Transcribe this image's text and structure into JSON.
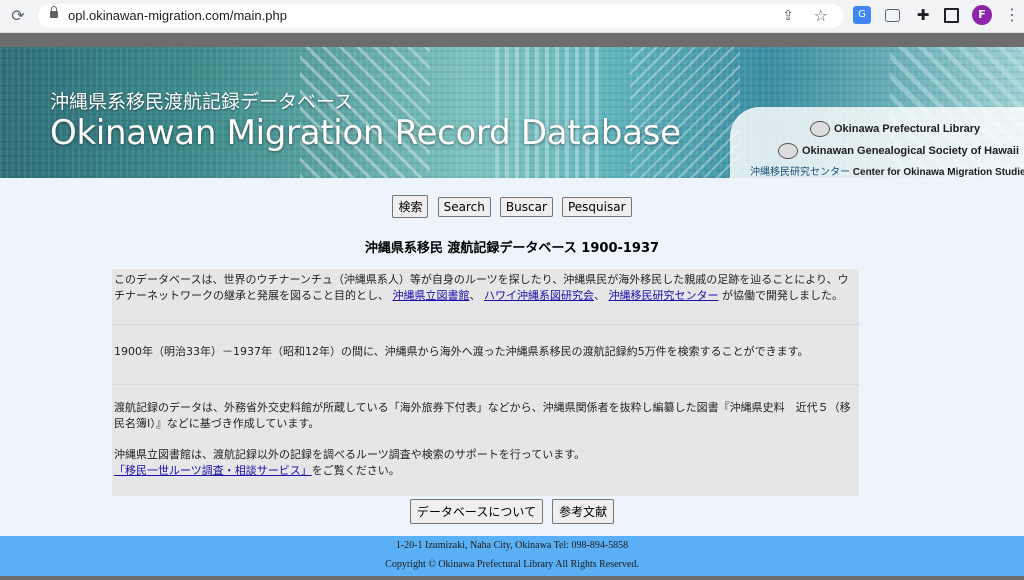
{
  "browser": {
    "url": "opl.okinawan-migration.com/main.php",
    "profile_initial": "F",
    "translate_icon_text": "G"
  },
  "banner": {
    "jp_title": "沖縄県系移民渡航記録データベース",
    "en_title": "Okinawan Migration Record Database",
    "org1": "Okinawa Prefectural Library",
    "org2": "Okinawan Genealogical Society of Hawaii",
    "org3_jp": "沖縄移民研究センター",
    "org3_en": "Center for Okinawa Migration Studies"
  },
  "language_buttons": [
    "検索",
    "Search",
    "Buscar",
    "Pesquisar"
  ],
  "heading": "沖縄県系移民 渡航記録データベース 1900-1937",
  "content": {
    "p1_text_a": "このデータベースは、世界のウチナーンチュ（沖縄県系人）等が自身のルーツを探したり、沖縄県民が海外移民した親戚の足跡を辿ることにより、ウチナーネットワークの継承と発展を図ること目的とし、",
    "link1": "沖縄県立図書館",
    "sep1": "、",
    "link2": "ハワイ沖縄系図研究会",
    "sep2": "、",
    "link3": "沖縄移民研究センター",
    "p1_text_b": " が協働で開発しました。",
    "p2": "1900年（明治33年）－1937年（昭和12年）の間に、沖縄県から海外へ渡った沖縄県系移民の渡航記録約5万件を検索することができます。",
    "p3": "渡航記録のデータは、外務省外交史料館が所蔵している「海外旅券下付表」などから、沖縄県関係者を抜粋し編纂した図書『沖縄県史料　近代５（移民名簿Ⅰ）』などに基づき作成しています。",
    "p4_text": "沖縄県立図書館は、渡航記録以外の記録を調べるルーツ調査や検索のサポートを行っています。",
    "p4_link": "「移民一世ルーツ調査・相談サービス」",
    "p4_tail": "をご覧ください。"
  },
  "bottom_buttons": {
    "about": "データベースについて",
    "references": "参考文献"
  },
  "footer": {
    "address": "1-20-1 Izumizaki, Naha City, Okinawa Tel: 098-894-5858",
    "copyright": "Copyright © Okinawa Prefectural Library All Rights Reserved."
  }
}
